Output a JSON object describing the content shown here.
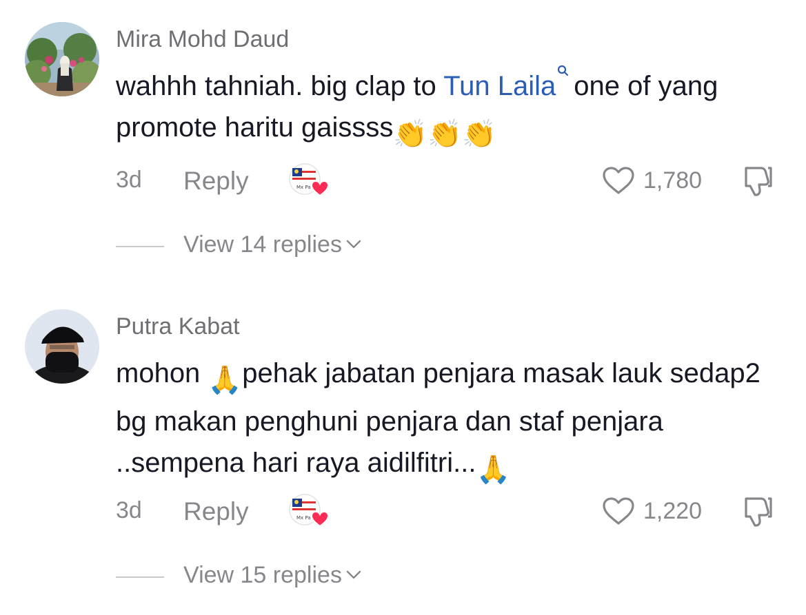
{
  "colors": {
    "text": "#161823",
    "secondary": "#86878b",
    "username": "#6e6e73",
    "mention": "#2b5db7",
    "heart": "#fe2c55"
  },
  "comments": [
    {
      "username": "Mira Mohd Daud",
      "text_before": "wahhh tahniah. big clap to ",
      "mention": "Tun Laila",
      "text_after": "one of yang promote haritu gaissss",
      "emoji": "👏👏👏",
      "time": "3d",
      "reply_label": "Reply",
      "like_count": "1,780",
      "view_replies": "View 14 replies",
      "avatar_icon": "avatar-photo-garden",
      "creator_like_icon": "creator-liked-badge-icon"
    },
    {
      "username": "Putra Kabat",
      "text_before": "mohon ",
      "emoji_inline": "🙏",
      "text_after": "pehak jabatan penjara masak lauk sedap2 bg makan penghuni penjara dan staf penjara ..sempena hari raya aidilfitri...",
      "emoji": "🙏",
      "time": "3d",
      "reply_label": "Reply",
      "like_count": "1,220",
      "view_replies": "View 15 replies",
      "avatar_icon": "avatar-photo-cap",
      "creator_like_icon": "creator-liked-badge-icon"
    }
  ]
}
